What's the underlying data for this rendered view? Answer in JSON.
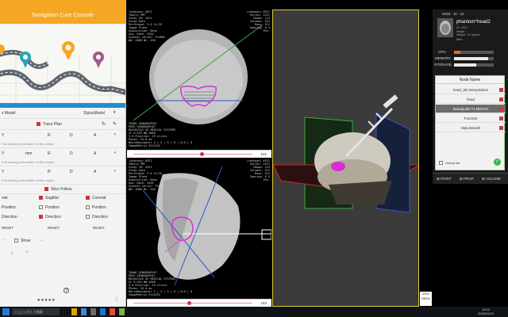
{
  "app": {
    "title": "Navigation Cure Console"
  },
  "left": {
    "model_label": "x Model",
    "model_select": "StylusModel",
    "trace_plan": "Trace Plan",
    "tracking_note": "Full tracking information of this object",
    "row1": [
      "Y",
      "R",
      "D",
      "A"
    ],
    "row2": [
      "Y",
      "mm",
      "R",
      "D",
      "A"
    ],
    "row3": [
      "Y",
      "R",
      "D",
      "A"
    ],
    "slice_follow": "Slice Follow",
    "axial": "xial",
    "sagittal": "Sagittal",
    "coronal": "Coronal",
    "position": "Position",
    "direction": "Direction",
    "reset": "RESET",
    "show": "Show",
    "page_num": "2",
    "page_plus": "+",
    "help": "?"
  },
  "viewer_top": {
    "overlay_tl": "(unknown) #321\nfamily PM?\nStudy ID: 4321\nStudy Date\nPerformed: 5.0 14:35\nImage Plane\nAcquisition: None\nAcq. Date: 2016\nScanner serial: ProMAC\nWW: 4000 WL: 450",
    "overlay_tr": "(unknown) #321\nSeries: 4321\nImage: 123\nColumns: 512\nRows: 512\nSpacing: 0.5\nPos:",
    "overlay_bl": "TRANS GENOGRAPHIC\nPOSE GENOGRAPHIC\nMAJUSCULE GE MEDICAL SYSTEMS\nSL 0.625 WW 4000\n5.0 Position: 19 slices\nPhase: 53.6 ms\nNeuroNavigator 2 | 4 | 5 | 0 | 0.0 | 0\nImageMatrix 512x512",
    "slider_value": "101"
  },
  "viewer_bottom": {
    "overlay_tl": "(unknown) #321\nfamily PM?\nStudy ID: 4321\nStudy Date\nPerformed: 5.0 14:35\nImage Plane\nAcquisition: None\nAcq. Date: 2016\nScanner serial: ProMAC\nWW: 4000 WL: 450",
    "overlay_tr": "(unknown) #321\nSeries: 4321\nImage: 123\nColumns: 512\nRows: 512\nSpacing: 0.5\nPos:",
    "overlay_bl": "TRANS GENOGRAPHIC\nPOSE GENOGRAPHIC\nMAJUSCULE GE MEDICAL SYSTEMS\nSL 0.625 WW 4000\n5.0 Position: 19 slices\nPhase: 53.6 ms\nNeuroNavigator 2 | 4 | 5 | 0 | 0.0 | 0\nImageMatrix 512x512",
    "slider_value": "163"
  },
  "coords": [
    "2951",
    "25600"
  ],
  "right": {
    "date": "2018 - 11 - 12",
    "patient_name": "phantom^head2",
    "patient_id": "ID : 4321",
    "patient_info": "Height :\nWeight : 5.0 kg 5cc",
    "patient_extra": "Birth :",
    "cpu": "CPU",
    "memory": "MEMORY",
    "storage": "STORAGE",
    "cpu_usage": 0.15,
    "memory_usage": 0.85,
    "storage_usage": 0.55,
    "node_header": "Node Name",
    "nodes": [
      "head_3D-interpolation",
      "head",
      "dunuipu3D T1 BRAVO",
      "PointSet",
      "StylusModel"
    ],
    "selected_node": 2,
    "global_init": "Global Init",
    "tabs": [
      "POINT",
      "PROP",
      "VOLUME"
    ]
  },
  "taskbar": {
    "time": "19:12",
    "date": "2018/11/12",
    "search": "ここに入力して検索"
  },
  "colors": {
    "accent_orange": "#f5a623",
    "check_red": "#d0343a",
    "magenta_contour": "#d62fd6",
    "frame_yellow": "#e0c93a"
  }
}
